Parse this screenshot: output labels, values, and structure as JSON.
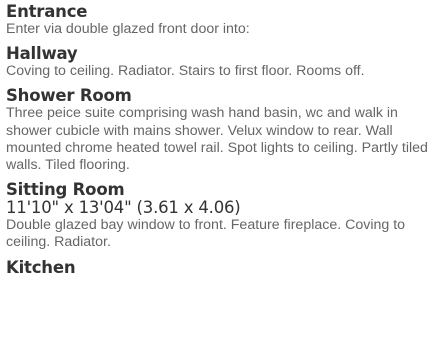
{
  "sections": [
    {
      "heading": "Entrance",
      "text": "Enter via double glazed front door into:"
    },
    {
      "heading": "Hallway",
      "text": "Coving to ceiling. Radiator. Stairs to first floor. Rooms off."
    },
    {
      "heading": "Shower Room",
      "text": "Three peice suite comprising wash hand basin, wc and walk in shower cubicle with mains shower. Velux window to rear. Wall mounted chrome heated towel rail. Spot lights to ceiling. Partly tiled walls. Tiled flooring."
    },
    {
      "heading": "Sitting Room",
      "dimensions": "11'10\" x 13'04\" (3.61 x 4.06)",
      "text": "Double glazed bay window to front. Feature fireplace. Coving to ceiling. Radiator."
    },
    {
      "heading": "Kitchen"
    }
  ]
}
